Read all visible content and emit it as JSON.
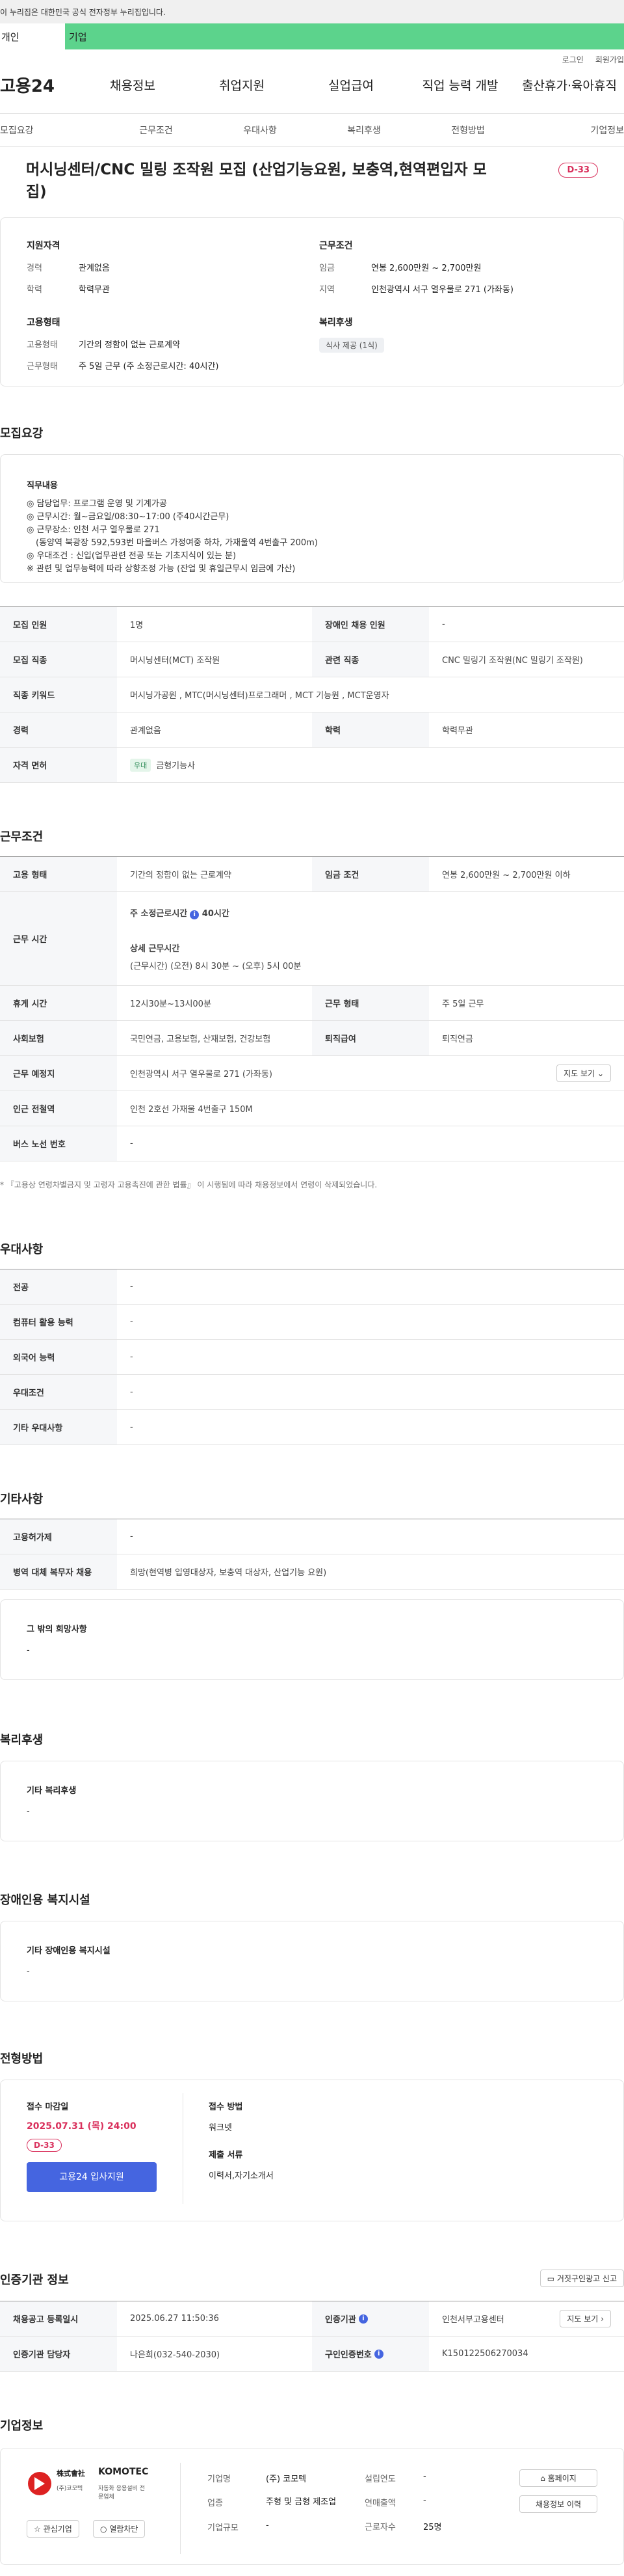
{
  "gov_banner": "이 누리집은 대한민국 공식 전자정부 누리집입니다.",
  "top_tabs": {
    "person": "개인",
    "company": "기업"
  },
  "util_links": [
    "로그인",
    "회원가입"
  ],
  "logo": "고용24",
  "gnb": [
    "채용정보",
    "취업지원",
    "실업급여",
    "직업 능력 개발",
    "출산휴가·육아휴직"
  ],
  "lnb": [
    "모집요강",
    "근무조건",
    "우대사항",
    "복리후생",
    "전형방법",
    "기업정보"
  ],
  "job": {
    "title": "머시닝센터/CNC 밀링 조작원 모집 (산업기능요원, 보충역,현역편입자 모집)",
    "dday": "D-33"
  },
  "summary": {
    "qual_head": "지원자격",
    "qual": [
      {
        "k": "경력",
        "v": "관계없음"
      },
      {
        "k": "학력",
        "v": "학력무관"
      }
    ],
    "cond_head": "근무조건",
    "cond": [
      {
        "k": "임금",
        "v": "연봉 2,600만원 ~ 2,700만원"
      },
      {
        "k": "지역",
        "v": "인천광역시 서구 열우물로 271 (가좌동)"
      }
    ],
    "emp_head": "고용형태",
    "emp": [
      {
        "k": "고용형태",
        "v": "기간의 정함이 없는 근로계약"
      },
      {
        "k": "근무형태",
        "v": "주 5일 근무 (주 소정근로시간: 40시간)"
      }
    ],
    "welfare_head": "복리후생",
    "welfare_chip": "식사 제공 (1식)"
  },
  "recruit": {
    "title": "모집요강",
    "duty_head": "직무내용",
    "duty_lines": [
      "◎ 담당업무: 프로그램 운영 및 기계가공",
      "◎ 근무시간: 월~금요일/08:30~17:00 (주40시간근무)",
      "◎ 근무장소: 인천 서구 열우물로 271",
      "  (동양역 북광장 592,593번 마을버스 가정여중 하차, 가재울역 4번출구 200m)",
      "◎ 우대조건 : 신입(업무관련 전공 또는 기초지식이 있는 분)",
      "※ 관련 및 업무능력에 따라 상향조정 가능 (잔업 및 휴일근무시 임금에 가산)"
    ],
    "rows": [
      {
        "k1": "모집 인원",
        "v1": "1명",
        "k2": "장애인 채용 인원",
        "v2": "-"
      },
      {
        "k1": "모집 직종",
        "v1": "머시닝센터(MCT) 조작원",
        "k2": "관련 직종",
        "v2": "CNC 밀링기 조작원(NC 밀링기 조작원)"
      }
    ],
    "keyword_k": "직종 키워드",
    "keyword_v": "머시닝가공원 , MTC(머시닝센터)프로그래머 , MCT 기능원 , MCT운영자",
    "edu_row": {
      "k1": "경력",
      "v1": "관계없음",
      "k2": "학력",
      "v2": "학력무관"
    },
    "license_k": "자격 면허",
    "license_badge": "우대",
    "license_v": "금형기능사"
  },
  "work": {
    "title": "근무조건",
    "emp_type_k": "고용 형태",
    "emp_type_v": "기간의 정함이 없는 근로계약",
    "wage_k": "임금 조건",
    "wage_v": "연봉 2,600만원 ~ 2,700만원 이하",
    "hours_k": "근무 시간",
    "hours_weekly": "주 소정근로시간",
    "hours_weekly_v": "40시간",
    "hours_detail_head": "상세 근무시간",
    "hours_detail": "(근무시간) (오전) 8시 30분 ~ (오후) 5시 00분",
    "rest_k": "휴게 시간",
    "rest_v": "12시30분~13시00분",
    "form_k": "근무 형태",
    "form_v": "주 5일 근무",
    "ins_k": "사회보험",
    "ins_v": "국민연금, 고용보험, 산재보험, 건강보험",
    "pension_k": "퇴직급여",
    "pension_v": "퇴직연금",
    "place_k": "근무 예정지",
    "place_v": "인천광역시 서구 열우물로 271 (가좌동)",
    "map_btn": "지도 보기",
    "subway_k": "인근 전철역",
    "subway_v": "인천 2호선 가재울 4번출구 150M",
    "bus_k": "버스 노선 번호",
    "bus_v": "-",
    "note": "* 『고용상 연령차별금지 및 고령자 고용촉진에 관한 법률』 이 시행됨에 따라 채용정보에서 연령이 삭제되었습니다."
  },
  "pref": {
    "title": "우대사항",
    "rows": [
      {
        "k": "전공",
        "v": "-"
      },
      {
        "k": "컴퓨터 활용 능력",
        "v": "-"
      },
      {
        "k": "외국어 능력",
        "v": "-"
      },
      {
        "k": "우대조건",
        "v": "-"
      },
      {
        "k": "기타 우대사항",
        "v": "-"
      }
    ]
  },
  "etc": {
    "title": "기타사항",
    "rows": [
      {
        "k": "고용허가제",
        "v": "-"
      },
      {
        "k": "병역 대체 복무자 채용",
        "v": "희망(현역병 입영대상자, 보충역 대상자, 산업기능 요원)"
      }
    ],
    "other_head": "그 밖의 희망사항",
    "other_v": "-"
  },
  "welfare": {
    "title": "복리후생",
    "head": "기타 복리후생",
    "v": "-"
  },
  "disabled": {
    "title": "장애인용 복지시설",
    "head": "기타 장애인용 복지시설",
    "v": "-"
  },
  "selection": {
    "title": "전형방법",
    "deadline_head": "접수 마감일",
    "deadline": "2025.07.31 (목) 24:00",
    "dday": "D-33",
    "apply_btn": "고용24 입사지원",
    "method_head": "접수 방법",
    "method_v": "워크넷",
    "docs_head": "제출 서류",
    "docs_v": "이력서,자기소개서"
  },
  "cert": {
    "title": "인증기관 정보",
    "report_btn": "거짓구인광고 신고",
    "rows": [
      {
        "k1": "채용공고 등록일시",
        "v1": "2025.06.27 11:50:36",
        "k2": "인증기관",
        "v2": "인천서부고용센터"
      },
      {
        "k1": "인증기관 담당자",
        "v1": "나은희(032-540-2030)",
        "k2": "구인인증번호",
        "v2": "K150122506270034"
      }
    ],
    "map_btn": "지도 보기"
  },
  "company": {
    "title": "기업정보",
    "logo_ko": "株式會社",
    "logo_name": "KOMOTEC",
    "logo_sub1": "(주)코모텍",
    "logo_sub2": "자동화 응용설비 전문업체",
    "fav_btn": "관심기업",
    "block_btn": "열람차단",
    "fields": [
      {
        "k": "기업명",
        "v": "(주) 코모텍"
      },
      {
        "k": "업종",
        "v": "주형 및 금형 제조업"
      },
      {
        "k": "기업규모",
        "v": "-"
      }
    ],
    "fields2": [
      {
        "k": "설립연도",
        "v": "-"
      },
      {
        "k": "연매출액",
        "v": "-"
      },
      {
        "k": "근로자수",
        "v": "25명"
      }
    ],
    "homepage_btn": "홈페이지",
    "history_btn": "채용정보 이력"
  },
  "colors": {
    "accent": "#4565e0",
    "dday": "#d9305c",
    "green": "#5cd38c"
  }
}
